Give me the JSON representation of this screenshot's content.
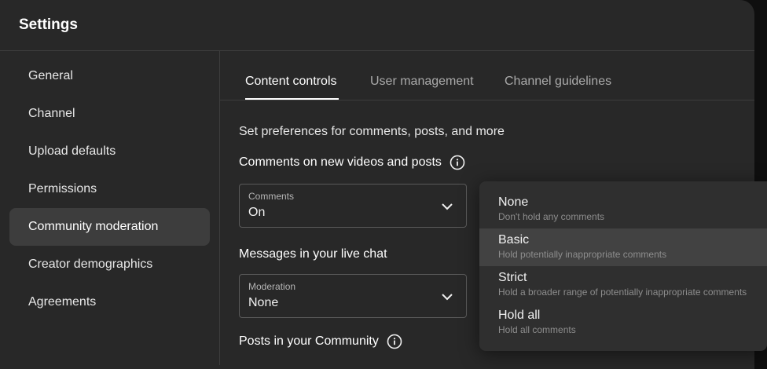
{
  "header": {
    "title": "Settings"
  },
  "sidebar": {
    "items": [
      {
        "label": "General"
      },
      {
        "label": "Channel"
      },
      {
        "label": "Upload defaults"
      },
      {
        "label": "Permissions"
      },
      {
        "label": "Community moderation",
        "active": true
      },
      {
        "label": "Creator demographics"
      },
      {
        "label": "Agreements"
      }
    ]
  },
  "tabs": [
    {
      "label": "Content controls",
      "active": true
    },
    {
      "label": "User management"
    },
    {
      "label": "Channel guidelines"
    }
  ],
  "content": {
    "description": "Set preferences for comments, posts, and more",
    "comments_section": {
      "heading": "Comments on new videos and posts",
      "select_label": "Comments",
      "select_value": "On"
    },
    "live_chat_section": {
      "heading": "Messages in your live chat",
      "select_label": "Moderation",
      "select_value": "None"
    },
    "posts_section": {
      "heading": "Posts in your Community"
    }
  },
  "dropdown": {
    "options": [
      {
        "title": "None",
        "subtitle": "Don't hold any comments"
      },
      {
        "title": "Basic",
        "subtitle": "Hold potentially inappropriate comments",
        "highlighted": true
      },
      {
        "title": "Strict",
        "subtitle": "Hold a broader range of potentially inappropriate comments"
      },
      {
        "title": "Hold all",
        "subtitle": "Hold all comments"
      }
    ]
  },
  "colors": {
    "dialog_bg": "#282828",
    "active_item_bg": "#3d3d3d",
    "dropdown_bg": "#2f2f2f",
    "dropdown_highlight": "#424242"
  },
  "icons": {
    "info": "info-circle-icon",
    "chevron": "chevron-down-icon"
  }
}
